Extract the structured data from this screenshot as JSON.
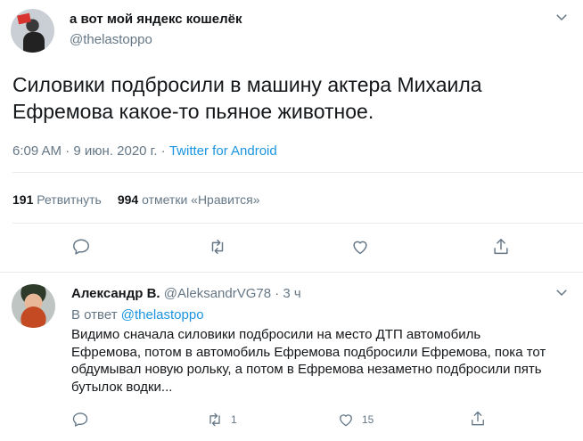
{
  "tweet": {
    "display_name": "а вот мой яндекс кошелёк",
    "handle": "@thelastoppo",
    "text": "Силовики подбросили в машину актера Михаила Ефремова какое-то пьяное животное.",
    "time": "6:09 AM",
    "date": "9 июн. 2020 г.",
    "separator": "·",
    "source": "Twitter for Android",
    "retweets_count": "191",
    "retweets_label": "Ретвитнуть",
    "likes_count": "994",
    "likes_label": "отметки «Нравится»"
  },
  "reply": {
    "display_name": "Александр В.",
    "handle": "@AleksandrVG78",
    "separator": "·",
    "age": "3 ч",
    "reply_to_label": "В ответ",
    "reply_to_handle": "@thelastoppo",
    "text": "Видимо сначала силовики подбросили на место ДТП автомобиль Ефремова, потом в автомобиль Ефремова подбросили Ефремова, пока тот обдумывал новую рольку, а потом в Ефремова незаметно подбросили пять бутылок водки...",
    "retweets_count": "1",
    "likes_count": "15"
  },
  "colors": {
    "link": "#1b95e0",
    "muted": "#657786",
    "text": "#14171a",
    "divider": "#e6ecf0"
  },
  "icons": [
    "chevron-down-icon",
    "reply-icon",
    "retweet-icon",
    "like-icon",
    "share-icon"
  ]
}
